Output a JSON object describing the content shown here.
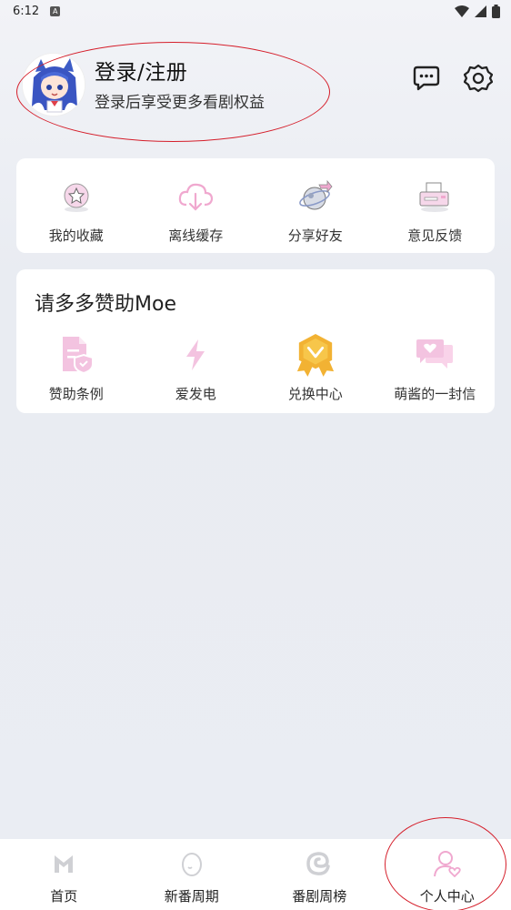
{
  "status_bar": {
    "time": "6:12",
    "notification_icon": "a-icon"
  },
  "profile": {
    "title": "登录/注册",
    "subtitle": "登录后享受更多看剧权益",
    "message_icon": "message-icon",
    "settings_icon": "gear-icon"
  },
  "quick_actions": [
    {
      "label": "我的收藏",
      "icon": "favorite-star-icon"
    },
    {
      "label": "离线缓存",
      "icon": "cloud-download-icon"
    },
    {
      "label": "分享好友",
      "icon": "share-planet-icon"
    },
    {
      "label": "意见反馈",
      "icon": "feedback-printer-icon"
    }
  ],
  "sponsor": {
    "title": "请多多赞助Moe",
    "items": [
      {
        "label": "赞助条例",
        "icon": "document-shield-icon"
      },
      {
        "label": "爱发电",
        "icon": "lightning-icon"
      },
      {
        "label": "兑换中心",
        "icon": "badge-ribbon-icon"
      },
      {
        "label": "萌酱的一封信",
        "icon": "chat-heart-icon"
      }
    ]
  },
  "bottom_nav": [
    {
      "label": "首页",
      "icon": "home-m-icon"
    },
    {
      "label": "新番周期",
      "icon": "egg-icon"
    },
    {
      "label": "番剧周榜",
      "icon": "swirl-icon"
    },
    {
      "label": "个人中心",
      "icon": "person-heart-icon"
    }
  ],
  "colors": {
    "accent_pink": "#f0a8cf",
    "highlight_red": "#d51e2a",
    "gold": "#f2b233"
  }
}
